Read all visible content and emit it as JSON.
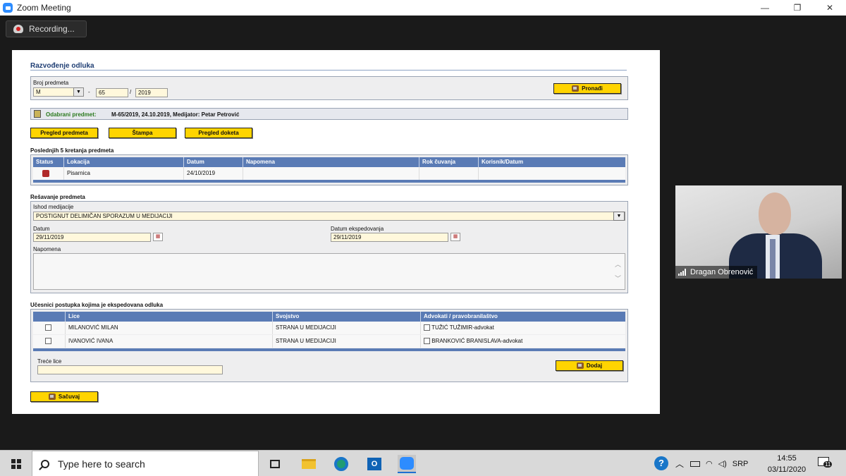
{
  "window": {
    "title": "Zoom Meeting",
    "minimize": "—",
    "restore": "❐",
    "close": "✕"
  },
  "zoom": {
    "recording_label": "Recording..."
  },
  "app": {
    "title": "Razvođenje odluka",
    "broj_predmeta": {
      "label": "Broj predmeta",
      "type_value": "M",
      "sep1": "-",
      "number": "65",
      "sep2": "/",
      "year": "2019",
      "find_button": "Pronađi"
    },
    "selected": {
      "label": "Odabrani predmet:",
      "value": "M-65/2019, 24.10.2019, Medijator: Petar Petrović"
    },
    "buttons": {
      "pregled_predmeta": "Pregled predmeta",
      "stampa": "Štampa",
      "pregled_doketa": "Pregled doketa"
    },
    "movements": {
      "title": "Poslednjih 5 kretanja predmeta",
      "columns": [
        "Status",
        "Lokacija",
        "Datum",
        "Napomena",
        "Rok čuvanja",
        "Korisnik/Datum"
      ],
      "rows": [
        {
          "lokacija": "Pisarnica",
          "datum": "24/10/2019",
          "napomena": "",
          "rok": "",
          "korisnik": ""
        }
      ]
    },
    "resolve": {
      "title": "Rešavanje predmeta",
      "ishod_label": "Ishod medijacije",
      "ishod_value": "POSTIGNUT DELIMIČAN SPORAZUM U MEDIJACIJI",
      "datum_label": "Datum",
      "datum_value": "29/11/2019",
      "datum_eksp_label": "Datum ekspedovanja",
      "datum_eksp_value": "29/11/2019",
      "napomena_label": "Napomena"
    },
    "participants": {
      "title": "Učesnici postupka kojima je ekspedovana odluka",
      "columns": [
        "",
        "Lice",
        "Svojstvo",
        "Advokati / pravobranilaštvo"
      ],
      "rows": [
        {
          "lice": "MILANOVIĆ MILAN",
          "svojstvo": "STRANA U MEDIJACIJI",
          "advokat": "TUŽIĆ TUŽIMIR-advokat"
        },
        {
          "lice": "IVANOVIĆ IVANA",
          "svojstvo": "STRANA U MEDIJACIJI",
          "advokat": "BRANKOVIĆ BRANISLAVA-advokat"
        }
      ],
      "trece_lice_label": "Treće lice",
      "add_button": "Dodaj"
    },
    "save_button": "Sačuvaj"
  },
  "participant_tile": {
    "name": "Dragan Obrenović"
  },
  "taskbar": {
    "search_placeholder": "Type here to search",
    "language": "SRP",
    "time": "14:55",
    "date": "03/11/2020",
    "notifications_count": "11"
  }
}
